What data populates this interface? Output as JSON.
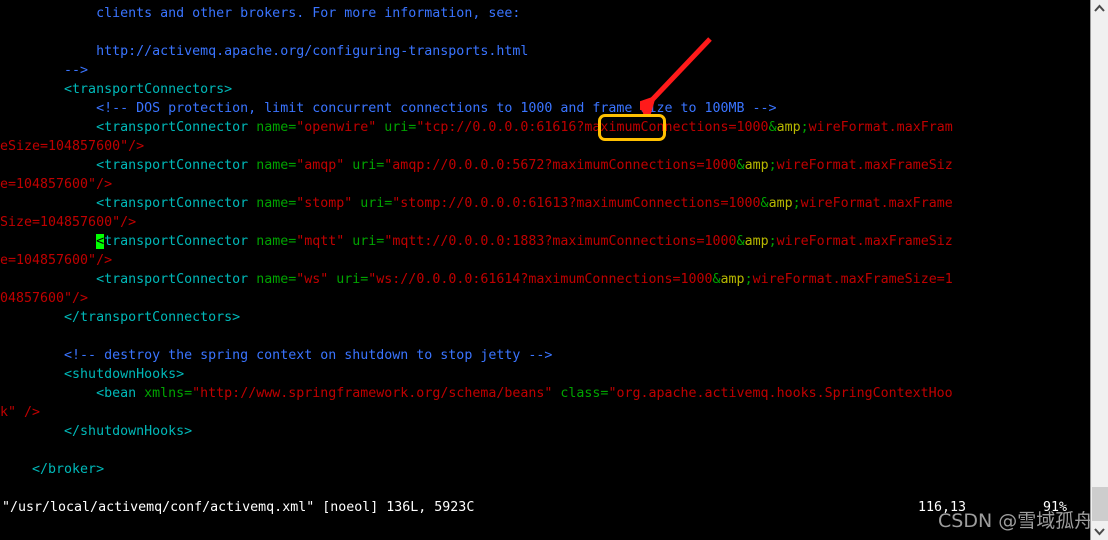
{
  "editor": {
    "name": "vim",
    "background": "#000000",
    "cursor_color": "#00ff00",
    "lines": [
      {
        "id": "l1",
        "indent": 0,
        "segments": [
          {
            "t": "            clients and other brokers. For more information, see:",
            "c": "comment"
          }
        ]
      },
      {
        "id": "l2",
        "indent": 0,
        "segments": [
          {
            "t": "",
            "c": "plain"
          }
        ]
      },
      {
        "id": "l3",
        "indent": 0,
        "segments": [
          {
            "t": "            http://activemq.apache.org/configuring-transports.html",
            "c": "comment"
          }
        ]
      },
      {
        "id": "l4",
        "indent": 0,
        "segments": [
          {
            "t": "        -->",
            "c": "comment"
          }
        ]
      },
      {
        "id": "l5",
        "indent": 0,
        "segments": [
          {
            "t": "        <transportConnectors>",
            "c": "tag"
          }
        ]
      },
      {
        "id": "l6",
        "indent": 0,
        "segments": [
          {
            "t": "            <!-- DOS protection, limit concurrent connections to 1000 and frame size to 100MB -->",
            "c": "comment"
          }
        ]
      },
      {
        "id": "l7",
        "indent": 0,
        "segments": [
          {
            "t": "            <transportConnector ",
            "c": "tag"
          },
          {
            "t": "name=",
            "c": "attr"
          },
          {
            "t": "\"openwire\" ",
            "c": "str"
          },
          {
            "t": "uri=",
            "c": "attr"
          },
          {
            "t": "\"tcp://0.0.0.0:61616?maximumConnections=1000",
            "c": "str"
          },
          {
            "t": "&",
            "c": "amp"
          },
          {
            "t": "amp",
            "c": "amp-hl"
          },
          {
            "t": ";",
            "c": "amp"
          },
          {
            "t": "wireFormat.maxFram",
            "c": "str"
          }
        ]
      },
      {
        "id": "l7b",
        "indent": 0,
        "segments": [
          {
            "t": "eSize=104857600\"/>",
            "c": "str"
          }
        ]
      },
      {
        "id": "l8",
        "indent": 0,
        "segments": [
          {
            "t": "            <transportConnector ",
            "c": "tag"
          },
          {
            "t": "name=",
            "c": "attr"
          },
          {
            "t": "\"amqp\" ",
            "c": "str"
          },
          {
            "t": "uri=",
            "c": "attr"
          },
          {
            "t": "\"amqp://0.0.0.0:5672?maximumConnections=1000",
            "c": "str"
          },
          {
            "t": "&",
            "c": "amp"
          },
          {
            "t": "amp",
            "c": "amp-hl"
          },
          {
            "t": ";",
            "c": "amp"
          },
          {
            "t": "wireFormat.maxFrameSiz",
            "c": "str"
          }
        ]
      },
      {
        "id": "l8b",
        "indent": 0,
        "segments": [
          {
            "t": "e=104857600\"/>",
            "c": "str"
          }
        ]
      },
      {
        "id": "l9",
        "indent": 0,
        "segments": [
          {
            "t": "            <transportConnector ",
            "c": "tag"
          },
          {
            "t": "name=",
            "c": "attr"
          },
          {
            "t": "\"stomp\" ",
            "c": "str"
          },
          {
            "t": "uri=",
            "c": "attr"
          },
          {
            "t": "\"stomp://0.0.0.0:61613?maximumConnections=1000",
            "c": "str"
          },
          {
            "t": "&",
            "c": "amp"
          },
          {
            "t": "amp",
            "c": "amp-hl"
          },
          {
            "t": ";",
            "c": "amp"
          },
          {
            "t": "wireFormat.maxFrame",
            "c": "str"
          }
        ]
      },
      {
        "id": "l9b",
        "indent": 0,
        "segments": [
          {
            "t": "Size=104857600\"/>",
            "c": "str"
          }
        ]
      },
      {
        "id": "l10",
        "indent": 0,
        "segments": [
          {
            "t": "            ",
            "c": "tag"
          },
          {
            "t": "<",
            "c": "cursor"
          },
          {
            "t": "transportConnector ",
            "c": "tag"
          },
          {
            "t": "name=",
            "c": "attr"
          },
          {
            "t": "\"mqtt\" ",
            "c": "str"
          },
          {
            "t": "uri=",
            "c": "attr"
          },
          {
            "t": "\"mqtt://0.0.0.0:1883?maximumConnections=1000",
            "c": "str"
          },
          {
            "t": "&",
            "c": "amp"
          },
          {
            "t": "amp",
            "c": "amp-hl"
          },
          {
            "t": ";",
            "c": "amp"
          },
          {
            "t": "wireFormat.maxFrameSiz",
            "c": "str"
          }
        ]
      },
      {
        "id": "l10b",
        "indent": 0,
        "segments": [
          {
            "t": "e=104857600\"/>",
            "c": "str"
          }
        ]
      },
      {
        "id": "l11",
        "indent": 0,
        "segments": [
          {
            "t": "            <transportConnector ",
            "c": "tag"
          },
          {
            "t": "name=",
            "c": "attr"
          },
          {
            "t": "\"ws\" ",
            "c": "str"
          },
          {
            "t": "uri=",
            "c": "attr"
          },
          {
            "t": "\"ws://0.0.0.0:61614?maximumConnections=1000",
            "c": "str"
          },
          {
            "t": "&",
            "c": "amp"
          },
          {
            "t": "amp",
            "c": "amp-hl"
          },
          {
            "t": ";",
            "c": "amp"
          },
          {
            "t": "wireFormat.maxFrameSize=1",
            "c": "str"
          }
        ]
      },
      {
        "id": "l11b",
        "indent": 0,
        "segments": [
          {
            "t": "04857600\"/>",
            "c": "str"
          }
        ]
      },
      {
        "id": "l12",
        "indent": 0,
        "segments": [
          {
            "t": "        </transportConnectors>",
            "c": "tag"
          }
        ]
      },
      {
        "id": "l13",
        "indent": 0,
        "segments": [
          {
            "t": "",
            "c": "plain"
          }
        ]
      },
      {
        "id": "l14",
        "indent": 0,
        "segments": [
          {
            "t": "        <!-- destroy the spring context on shutdown to stop jetty -->",
            "c": "comment"
          }
        ]
      },
      {
        "id": "l15",
        "indent": 0,
        "segments": [
          {
            "t": "        <shutdownHooks>",
            "c": "tag"
          }
        ]
      },
      {
        "id": "l16",
        "indent": 0,
        "segments": [
          {
            "t": "            <bean ",
            "c": "tag"
          },
          {
            "t": "xmlns=",
            "c": "attr"
          },
          {
            "t": "\"http://www.springframework.org/schema/beans\" ",
            "c": "str"
          },
          {
            "t": "class=",
            "c": "attr"
          },
          {
            "t": "\"org.apache.activemq.hooks.SpringContextHoo",
            "c": "str"
          }
        ]
      },
      {
        "id": "l16b",
        "indent": 0,
        "segments": [
          {
            "t": "k\" />",
            "c": "str"
          }
        ]
      },
      {
        "id": "l17",
        "indent": 0,
        "segments": [
          {
            "t": "        </shutdownHooks>",
            "c": "tag"
          }
        ]
      },
      {
        "id": "l18",
        "indent": 0,
        "segments": [
          {
            "t": "",
            "c": "plain"
          }
        ]
      },
      {
        "id": "l19",
        "indent": 0,
        "segments": [
          {
            "t": "    </broker>",
            "c": "tag"
          }
        ]
      }
    ]
  },
  "status": {
    "file": "\"/usr/local/activemq/conf/activemq.xml\" [noeol] 136L, 5923C",
    "position": "116,13",
    "percent": "91%"
  },
  "annotations": {
    "highlight_box": {
      "label": ":61616?",
      "color": "#ffc000"
    },
    "arrow": {
      "color": "#ff1a1a",
      "direction": "down-left"
    }
  },
  "watermark": {
    "text": "CSDN @雪域孤舟",
    "color": "#b9b9b9"
  },
  "scrollbar": {
    "up_arrow": "⌃",
    "down_arrow": "⌄"
  }
}
